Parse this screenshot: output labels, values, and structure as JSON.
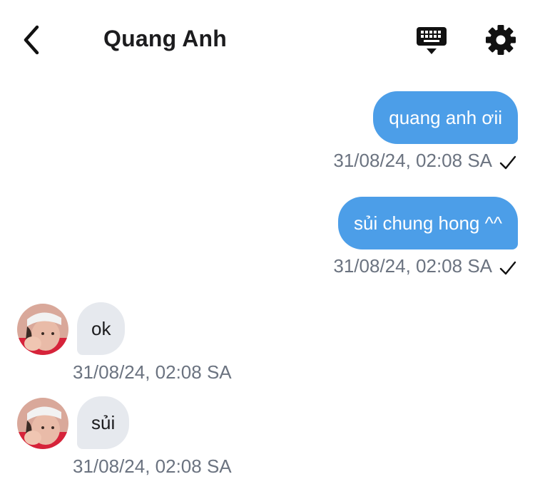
{
  "header": {
    "title": "Quang Anh",
    "back_icon": "chevron-left-icon",
    "keyboard_icon": "keyboard-icon",
    "settings_icon": "gear-icon"
  },
  "colors": {
    "outgoing_bubble": "#4c9ee8",
    "incoming_bubble": "#e6e9ee",
    "timestamp": "#6b7380"
  },
  "messages": [
    {
      "direction": "outgoing",
      "text": "quang anh ơii",
      "timestamp": "31/08/24, 02:08 SA",
      "status_icon": "check-icon"
    },
    {
      "direction": "outgoing",
      "text": "sủi chung hong ^^",
      "timestamp": "31/08/24, 02:08 SA",
      "status_icon": "check-icon"
    },
    {
      "direction": "incoming",
      "text": "ok",
      "timestamp": "31/08/24, 02:08 SA"
    },
    {
      "direction": "incoming",
      "text": "sủi",
      "timestamp": "31/08/24, 02:08 SA"
    }
  ]
}
